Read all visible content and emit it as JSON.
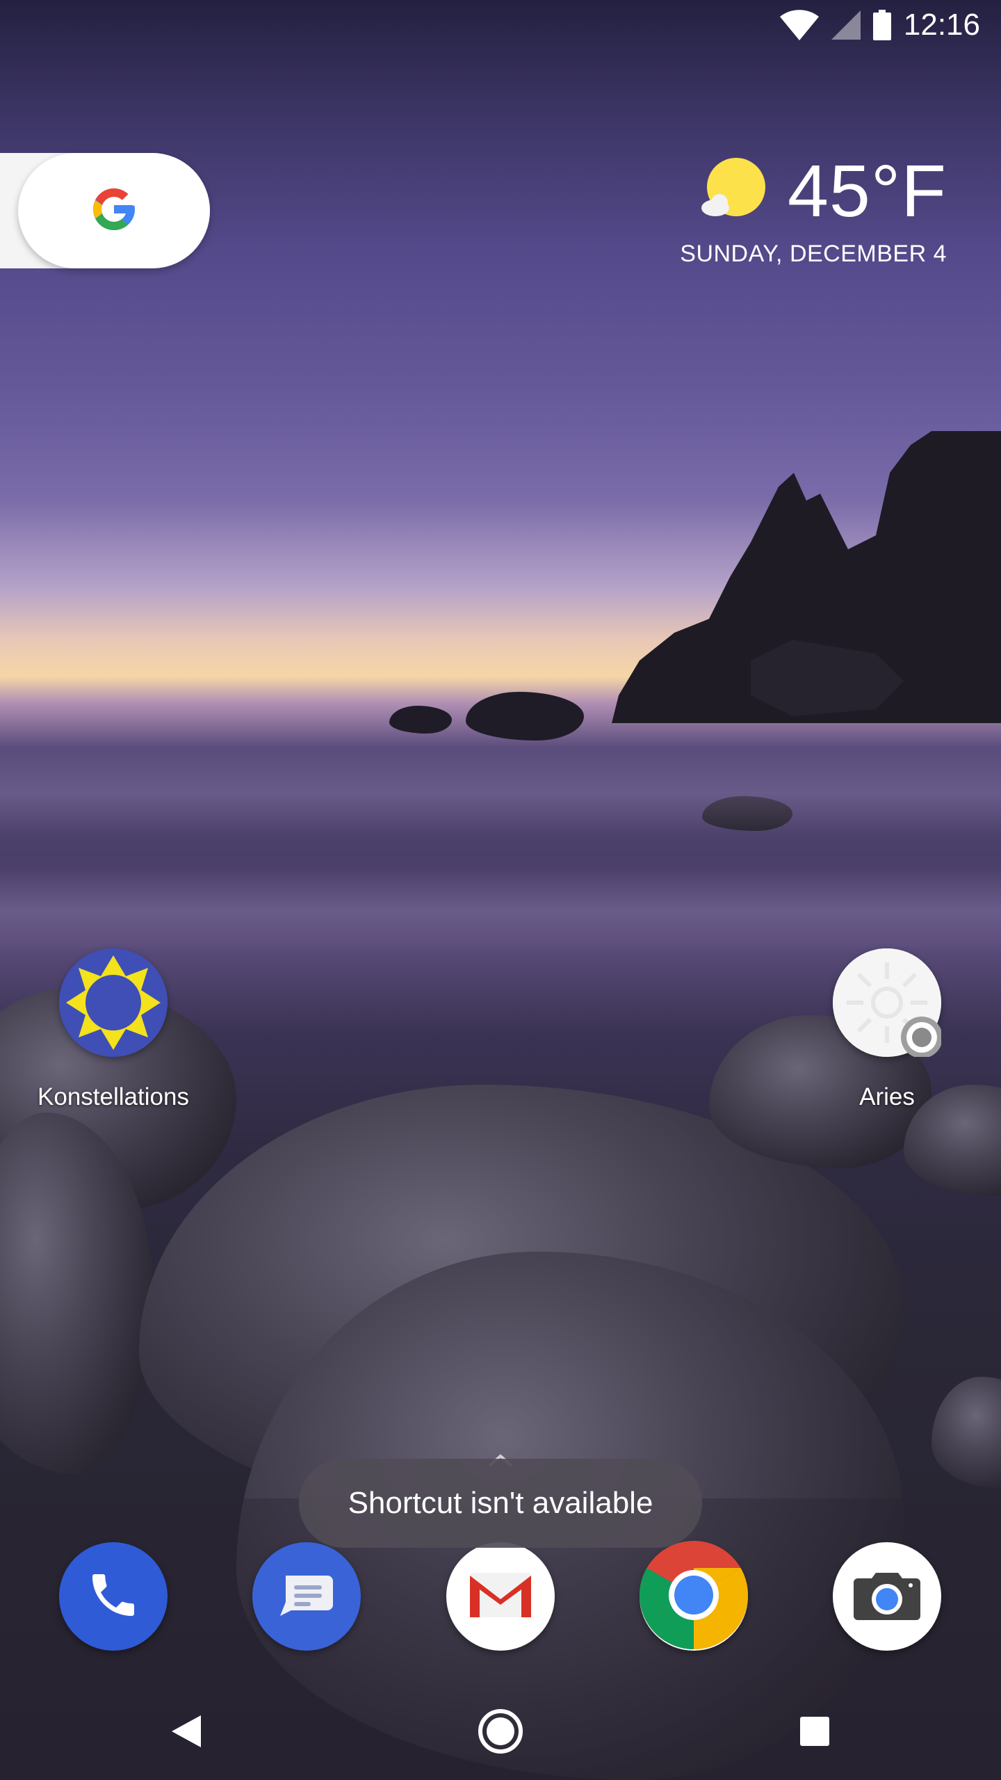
{
  "status_bar": {
    "time": "12:16",
    "icons": [
      "wifi-icon",
      "cell-signal-icon",
      "battery-icon"
    ]
  },
  "search_widget": {
    "icon": "google-g-icon"
  },
  "weather": {
    "icon": "partly-sunny-icon",
    "temperature": "45°F",
    "date": "SUNDAY, DECEMBER 4"
  },
  "home_apps": [
    {
      "label": "Konstellations",
      "icon": "konstellations-icon"
    },
    {
      "label": "Aries",
      "icon": "aries-icon"
    }
  ],
  "dock_apps": [
    {
      "name": "Phone",
      "icon": "phone-icon"
    },
    {
      "name": "Messages",
      "icon": "messages-icon"
    },
    {
      "name": "Gmail",
      "icon": "gmail-icon"
    },
    {
      "name": "Chrome",
      "icon": "chrome-icon"
    },
    {
      "name": "Camera",
      "icon": "camera-icon"
    }
  ],
  "toast": {
    "message": "Shortcut isn't available"
  },
  "nav_bar": {
    "buttons": [
      "back-icon",
      "home-icon",
      "recents-icon"
    ]
  },
  "colors": {
    "phone_blue": "#2f5bd6",
    "messages_blue": "#3a63d8",
    "konstellations_yellow": "#f3e21c",
    "konstellations_blue": "#3f4fb6",
    "sun_yellow": "#fde14a"
  }
}
